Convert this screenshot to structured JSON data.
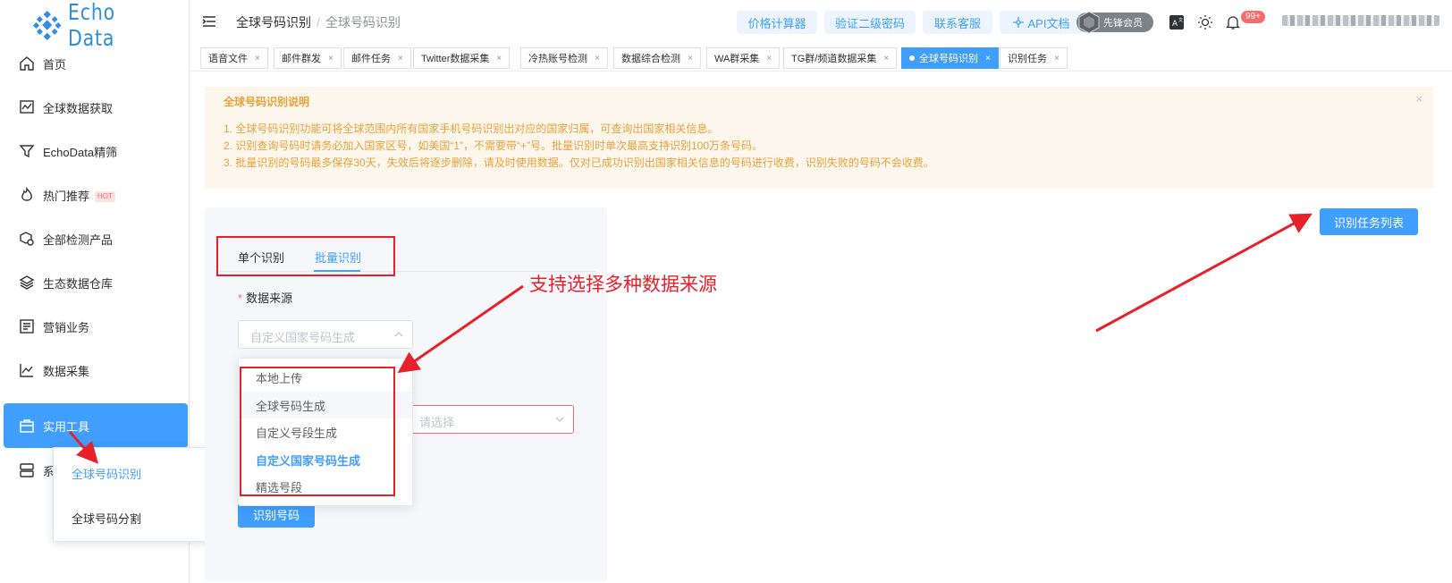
{
  "brand": {
    "logo_text": "Echo Data",
    "accent": "#409eff"
  },
  "sidebar": {
    "items": [
      {
        "label": "首页",
        "icon": "home-icon"
      },
      {
        "label": "全球数据获取",
        "icon": "chart-monitor-icon"
      },
      {
        "label": "EchoData精筛",
        "icon": "filter-icon"
      },
      {
        "label": "热门推荐",
        "icon": "flame-icon",
        "badge": "HOT"
      },
      {
        "label": "全部检测产品",
        "icon": "box-search-icon"
      },
      {
        "label": "生态数据仓库",
        "icon": "layers-icon"
      },
      {
        "label": "营销业务",
        "icon": "list-icon"
      },
      {
        "label": "数据采集",
        "icon": "chart-line-icon"
      },
      {
        "label": "实用工具",
        "icon": "briefcase-icon",
        "active": true
      },
      {
        "label": "系",
        "icon": "server-icon"
      }
    ],
    "submenu": [
      {
        "label": "全球号码识别",
        "active": true
      },
      {
        "label": "全球号码分割"
      }
    ]
  },
  "header": {
    "breadcrumb": [
      "全球号码识别",
      "全球号码识别"
    ],
    "buttons": {
      "price_calc": "价格计算器",
      "verify_pwd": "验证二级密码",
      "contact": "联系客服",
      "api_docs": "API文档"
    },
    "member_label": "先锋会员",
    "notification_badge": "99+"
  },
  "tabs": [
    {
      "label": "语音文件"
    },
    {
      "label": "邮件群发"
    },
    {
      "label": "邮件任务"
    },
    {
      "label": "Twitter数据采集"
    },
    {
      "label": "冷热账号检测"
    },
    {
      "label": "数据综合检测"
    },
    {
      "label": "WA群采集"
    },
    {
      "label": "TG群/频道数据采集"
    },
    {
      "label": "全球号码识别",
      "active": true
    },
    {
      "label": "识别任务"
    }
  ],
  "notice": {
    "title": "全球号码识别说明",
    "lines": [
      "1. 全球号码识别功能可将全球范围内所有国家手机号码识别出对应的国家归属，可查询出国家相关信息。",
      "2. 识别查询号码时请务必加入国家区号，如美国“1”，不需要带“+”号。批量识别时单次最高支持识别100万条号码。",
      "3. 批量识别的号码最多保存30天，失效后将逐步删除，请及时使用数据。仅对已成功识别出国家相关信息的号码进行收费，识别失败的号码不会收费。"
    ],
    "close": "×"
  },
  "main": {
    "task_list_button": "识别任务列表",
    "tabs": {
      "single": "单个识别",
      "batch": "批量识别"
    },
    "data_source": {
      "required_mark": "*",
      "label": "数据来源",
      "placeholder": "自定义国家号码生成",
      "options": [
        "本地上传",
        "全球号码生成",
        "自定义号段生成",
        "自定义国家号码生成",
        "精选号段"
      ],
      "selected_option": "自定义国家号码生成"
    },
    "second_select_placeholder": "请选择",
    "identify_button": "识别号码"
  },
  "annotation": {
    "text": "支持选择多种数据来源",
    "color": "#e8202a"
  }
}
